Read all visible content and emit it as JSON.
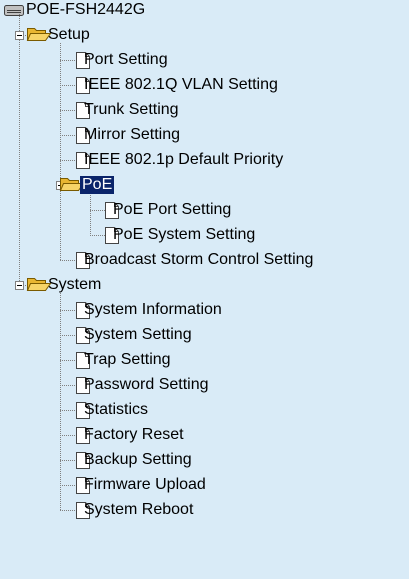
{
  "colors": {
    "panel_bg": "#d9ebf7",
    "selection_bg": "#0a246a",
    "selection_text": "#ffffff",
    "folder_fill": "#f6d467",
    "folder_edge": "#7a5b00"
  },
  "tree": {
    "root": {
      "label": "POE-FSH2442G",
      "icon": "switch-icon"
    },
    "setup": {
      "label": "Setup",
      "icon": "folder-open-icon",
      "toggle": "minus",
      "items": [
        {
          "label": "Port Setting",
          "icon": "page-icon"
        },
        {
          "label": "IEEE 802.1Q VLAN Setting",
          "icon": "page-icon"
        },
        {
          "label": "Trunk Setting",
          "icon": "page-icon"
        },
        {
          "label": "Mirror Setting",
          "icon": "page-icon"
        },
        {
          "label": "IEEE 802.1p Default Priority",
          "icon": "page-icon"
        }
      ],
      "poe": {
        "label": "PoE",
        "icon": "folder-open-icon",
        "toggle": "minus",
        "selected": true,
        "items": [
          {
            "label": "PoE Port Setting",
            "icon": "page-icon"
          },
          {
            "label": "PoE System Setting",
            "icon": "page-icon"
          }
        ]
      },
      "after_items": [
        {
          "label": "Broadcast Storm Control Setting",
          "icon": "page-icon"
        }
      ]
    },
    "system": {
      "label": "System",
      "icon": "folder-open-icon",
      "toggle": "minus",
      "items": [
        {
          "label": "System Information",
          "icon": "page-icon"
        },
        {
          "label": "System Setting",
          "icon": "page-icon"
        },
        {
          "label": "Trap Setting",
          "icon": "page-icon"
        },
        {
          "label": "Password Setting",
          "icon": "page-icon"
        },
        {
          "label": "Statistics",
          "icon": "page-icon"
        },
        {
          "label": "Factory Reset",
          "icon": "page-icon"
        },
        {
          "label": "Backup Setting",
          "icon": "page-icon"
        },
        {
          "label": "Firmware Upload",
          "icon": "page-icon"
        },
        {
          "label": "System Reboot",
          "icon": "page-icon"
        }
      ]
    }
  }
}
